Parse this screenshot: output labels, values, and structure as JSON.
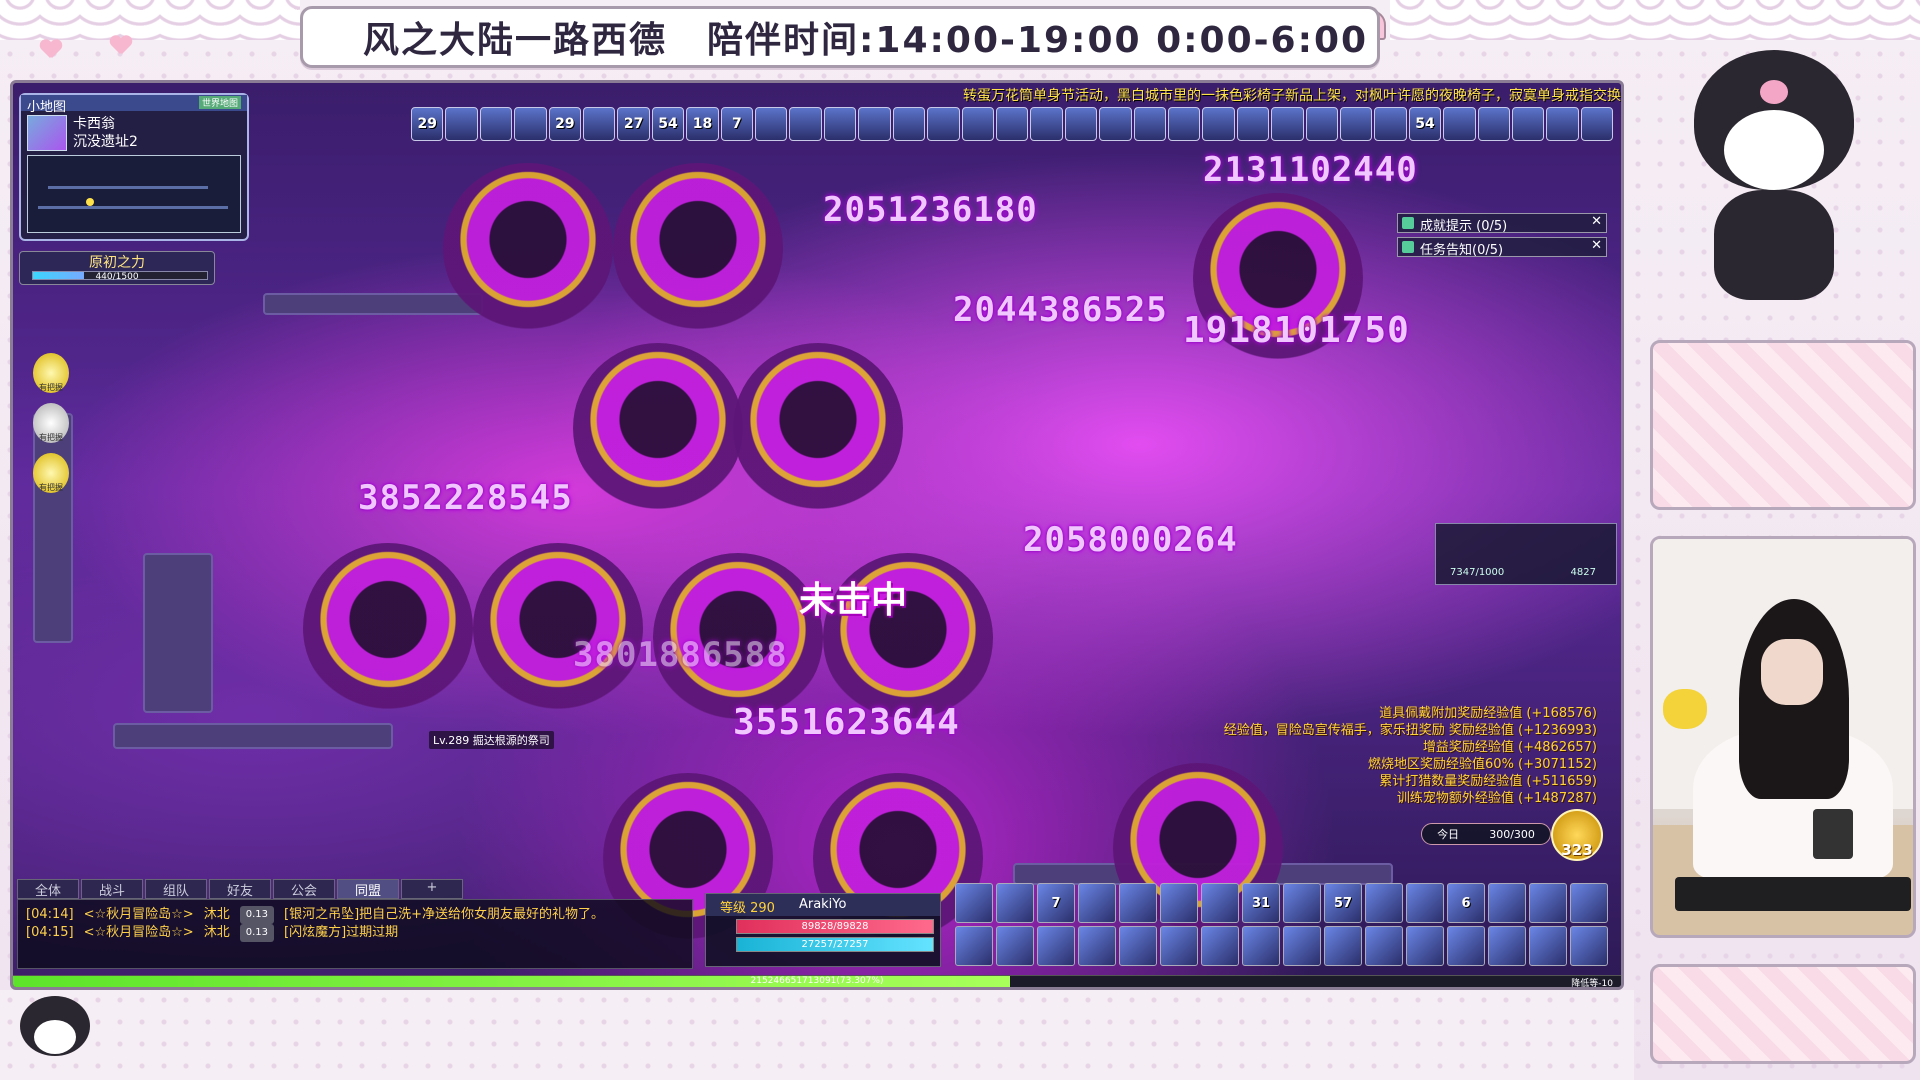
{
  "banner": {
    "title": "风之大陆一路西德",
    "schedule": "陪伴时间:14:00-19:00 0:00-6:00"
  },
  "game": {
    "ticker": "转蛋万花筒单身节活动，黑白城市里的一抹色彩椅子新品上架，对枫叶许愿的夜晚椅子，寂寞单身戒指交换",
    "minimap": {
      "header": "小地图",
      "world_map_btn": "世界地图",
      "region": "卡西翁",
      "area": "沉没遗址2"
    },
    "origin_power": {
      "label": "原初之力",
      "value": "440/1500"
    },
    "side_icons": [
      "有把握",
      "有把握",
      "有把握"
    ],
    "buffs": [
      "29",
      "",
      "",
      "",
      "29",
      "",
      "27",
      "54",
      "18",
      "7",
      "",
      "",
      "",
      "",
      "",
      "",
      "",
      "",
      "",
      "",
      "",
      "",
      "",
      "",
      "",
      "",
      "",
      "",
      "",
      "54",
      "",
      "",
      "",
      "",
      ""
    ],
    "tracker": [
      {
        "label": "成就提示 (0/5)"
      },
      {
        "label": "任务告知(0/5)"
      }
    ],
    "pet_panel": {
      "left": "7347/1000",
      "right": "4827"
    },
    "damage_numbers": [
      "2051236180",
      "2131102440",
      "2044386525",
      "1918101750",
      "3852228545",
      "2058000264",
      "3801886588",
      "3551623644"
    ],
    "status_text": "未击中",
    "mob_label": "Lv.289 掘达根源的祭司",
    "exp_log": [
      "道具佩戴附加奖励经验值 (+168576)",
      "经验值，冒险岛宣传福手，家乐扭奖励 奖励经验值 (+1236993)",
      "增益奖励经验值 (+4862657)",
      "燃烧地区奖励经验值60% (+3071152)",
      "累计打猎数量奖励经验值 (+511659)",
      "训练宠物额外经验值 (+1487287)"
    ],
    "daily": {
      "label": "今日",
      "value": "300/300"
    },
    "coin": "323",
    "chat_tabs": [
      "全体",
      "战斗",
      "组队",
      "好友",
      "公会",
      "同盟",
      "+"
    ],
    "chat_lines": [
      {
        "time": "[04:14]",
        "from": "<☆秋月冒险岛☆>",
        "name": "沐北",
        "lvl": "0.13",
        "msg": "[银河之吊坠]把自己洗+净送给你女朋友最好的礼物了。"
      },
      {
        "time": "[04:15]",
        "from": "<☆秋月冒险岛☆>",
        "name": "沐北",
        "lvl": "0.13",
        "msg": "[闪炫魔方]过期过期"
      }
    ],
    "player": {
      "level_label": "等级 290",
      "name": "ArakiYo",
      "hp": "89828/89828",
      "mp": "27257/27257"
    },
    "skills": [
      "",
      "",
      "7",
      "",
      "",
      "",
      "",
      "31",
      "",
      "57",
      "",
      "",
      "6",
      "",
      "",
      "",
      "",
      "",
      "",
      "",
      "",
      "",
      "",
      "",
      "",
      "",
      "",
      "",
      "",
      "",
      "",
      ""
    ],
    "exp_text": "215246651713091(73.307%)",
    "exp_right": "降低等-10"
  },
  "colors": {
    "frame_bg": "#f3eaf2",
    "game_purple": "#5b2a9a",
    "damage_glow": "#d000ff",
    "exp_gold": "#ffd23a",
    "hp": "#e0305c",
    "mp": "#19b3d6"
  }
}
